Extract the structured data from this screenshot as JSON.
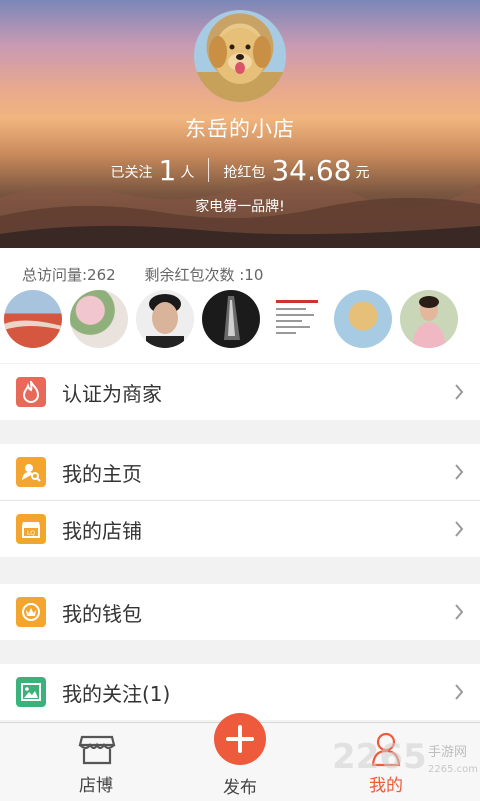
{
  "profile": {
    "shop_name": "东岳的小店",
    "following_label": "已关注",
    "following_count": "1",
    "following_unit": "人",
    "redpack_label": "抢红包",
    "redpack_amount": "34.68",
    "redpack_unit": "元",
    "slogan": "家电第一品牌!"
  },
  "visitors": {
    "total_visits": "总访问量:262",
    "remaining_redpacks": "剩余红包次数 :10"
  },
  "menu": {
    "certify": {
      "label": "认证为商家",
      "icon": "flame-icon",
      "color": "#e8685a"
    },
    "homepage": {
      "label": "我的主页",
      "icon": "user-search-icon",
      "color": "#f3a530"
    },
    "store": {
      "label": "我的店铺",
      "icon": "storefront-icon",
      "color": "#f3a530"
    },
    "wallet": {
      "label": "我的钱包",
      "icon": "crown-wallet-icon",
      "color": "#f3a530"
    },
    "follows": {
      "label": "我的关注(1)",
      "icon": "image-icon",
      "color": "#3bb27a"
    }
  },
  "tabbar": {
    "shop_tab": "店博",
    "publish_tab": "发布",
    "me_tab": "我的",
    "accent": "#ee5a3c"
  },
  "watermark": {
    "number": "2265",
    "site": "手游网",
    "domain": "2265.com"
  }
}
